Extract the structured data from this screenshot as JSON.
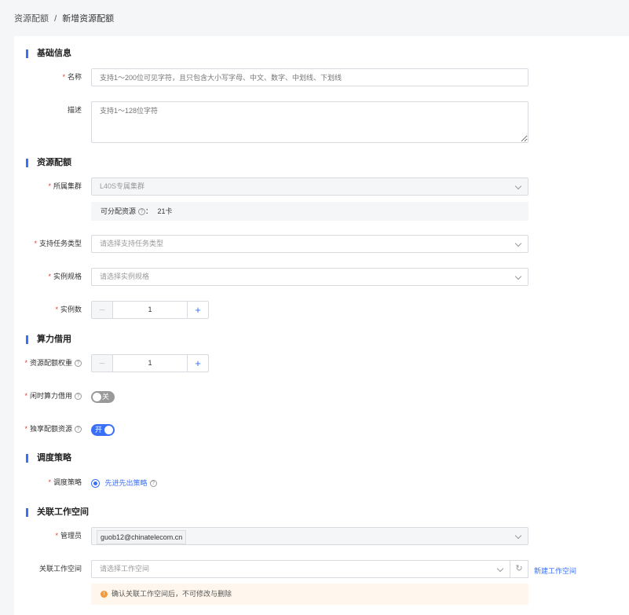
{
  "breadcrumb": {
    "parent": "资源配额",
    "sep": "/",
    "current": "新增资源配额"
  },
  "sections": {
    "basic": "基础信息",
    "quota": "资源配额",
    "borrow": "算力借用",
    "schedule": "调度策略",
    "workspace": "关联工作空间"
  },
  "form": {
    "name": {
      "label": "名称",
      "placeholder": "支持1～200位可见字符，且只包含大小写字母、中文、数字、中划线、下划线"
    },
    "desc": {
      "label": "描述",
      "placeholder": "支持1～128位字符"
    },
    "cluster": {
      "label": "所属集群",
      "value": "L40S专属集群"
    },
    "available": {
      "label": "可分配资源",
      "sep": "：",
      "value": "21卡"
    },
    "task_type": {
      "label": "支持任务类型",
      "placeholder": "请选择支持任务类型"
    },
    "spec": {
      "label": "实例规格",
      "placeholder": "请选择实例规格"
    },
    "count": {
      "label": "实例数",
      "value": "1",
      "minus": "−",
      "plus": "+"
    },
    "weight": {
      "label": "资源配额权重",
      "value": "1",
      "minus": "−",
      "plus": "+"
    },
    "idle_borrow": {
      "label": "闲时算力借用",
      "state": "关"
    },
    "exclusive": {
      "label": "独享配额资源",
      "state": "开"
    },
    "strategy": {
      "label": "调度策略",
      "option": "先进先出策略"
    },
    "admin": {
      "label": "管理员",
      "tag": "guob12@chinatelecom.cn"
    },
    "workspace": {
      "label": "关联工作空间",
      "placeholder": "请选择工作空间",
      "new_link": "新建工作空间",
      "warning": "确认关联工作空间后，不可修改与删除"
    }
  },
  "colors": {
    "accent": "#3a6ff7",
    "required": "#e53935",
    "warning_bg": "#fff7ed",
    "warning_icon": "#f59a3c"
  }
}
